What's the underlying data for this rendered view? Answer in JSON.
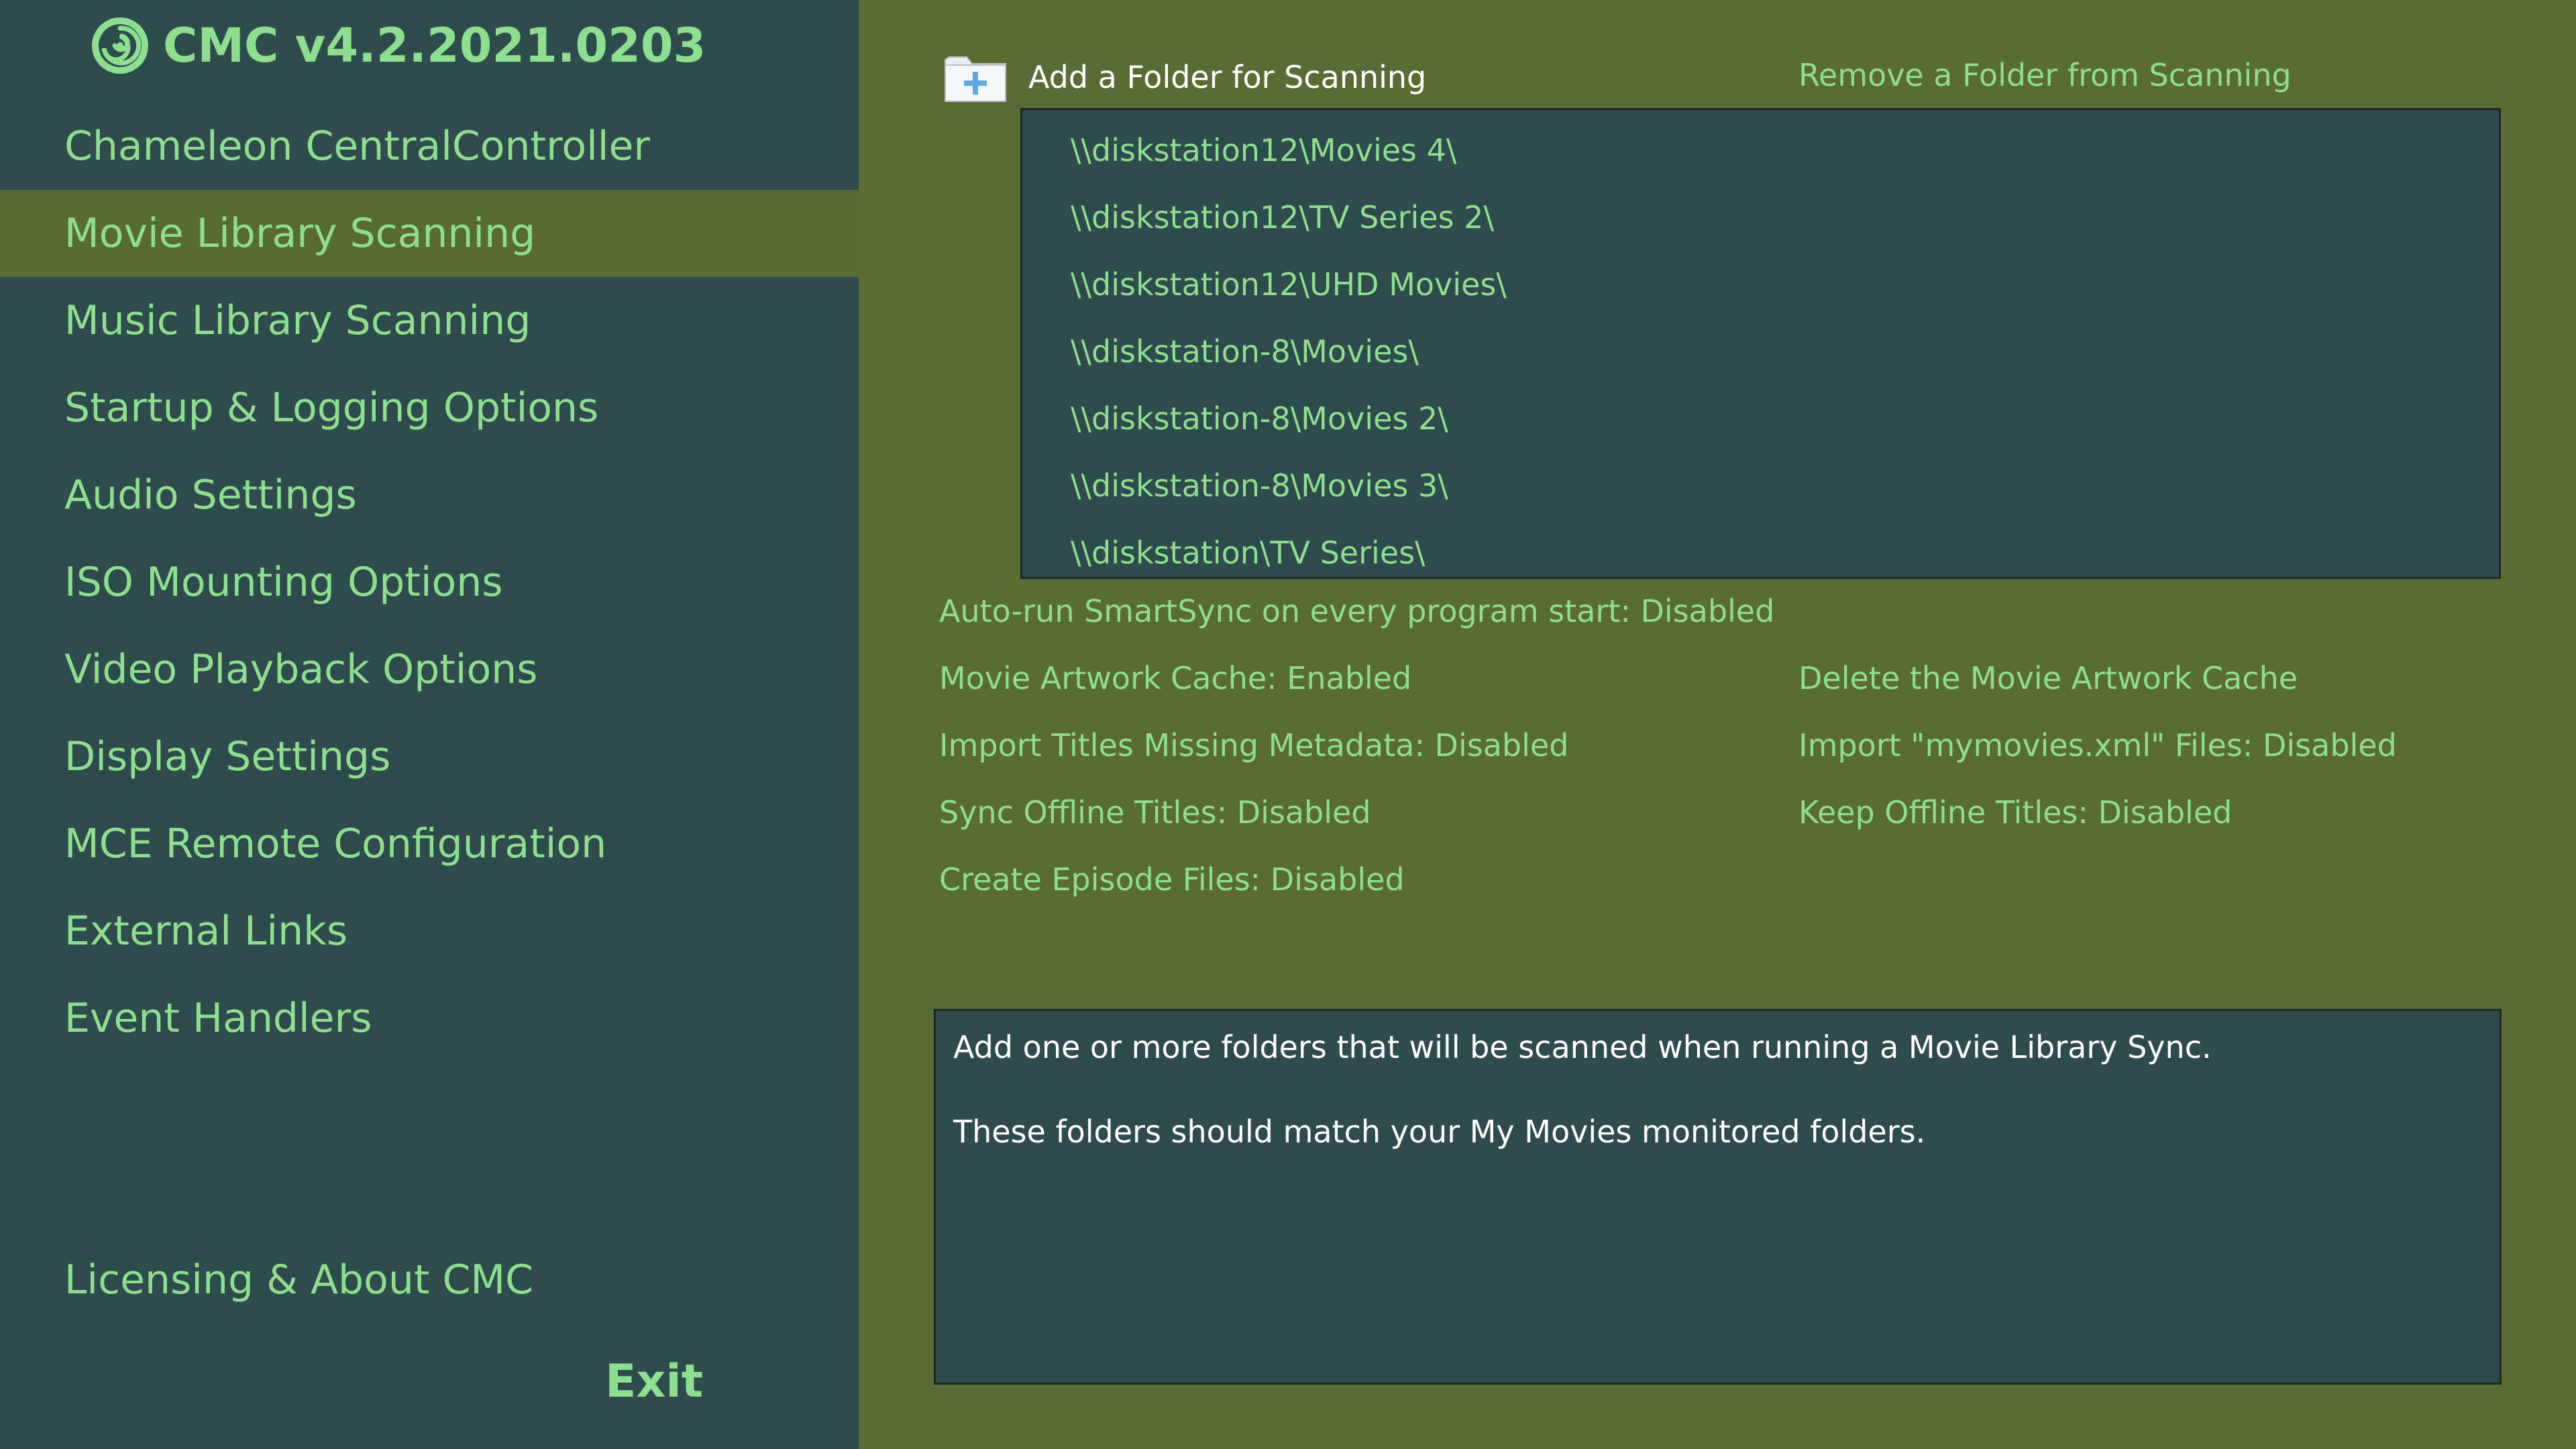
{
  "app": {
    "title": "CMC v4.2.2021.0203",
    "logo_icon": "chameleon-logo-icon"
  },
  "sidebar": {
    "items": [
      {
        "label": "Chameleon CentralController",
        "active": false
      },
      {
        "label": "Movie Library Scanning",
        "active": true
      },
      {
        "label": "Music Library Scanning",
        "active": false
      },
      {
        "label": "Startup & Logging Options",
        "active": false
      },
      {
        "label": "Audio Settings",
        "active": false
      },
      {
        "label": "ISO Mounting Options",
        "active": false
      },
      {
        "label": "Video Playback Options",
        "active": false
      },
      {
        "label": "Display Settings",
        "active": false
      },
      {
        "label": "MCE Remote Configuration",
        "active": false
      },
      {
        "label": "External Links",
        "active": false
      },
      {
        "label": "Event Handlers",
        "active": false
      }
    ],
    "licensing_label": "Licensing & About CMC",
    "exit_label": "Exit"
  },
  "main": {
    "add_folder_label": "Add a Folder for Scanning",
    "add_folder_icon": "add-folder-icon",
    "remove_folder_label": "Remove a Folder from Scanning",
    "folders": [
      "\\\\diskstation12\\Movies 4\\",
      "\\\\diskstation12\\TV Series 2\\",
      "\\\\diskstation12\\UHD Movies\\",
      "\\\\diskstation-8\\Movies\\",
      "\\\\diskstation-8\\Movies 2\\",
      "\\\\diskstation-8\\Movies 3\\",
      "\\\\diskstation\\TV Series\\"
    ],
    "options": {
      "auto_run": "Auto-run SmartSync on every program start:  Disabled",
      "artwork_cache": "Movie Artwork Cache:  Enabled",
      "delete_artwork": "Delete the Movie Artwork Cache",
      "import_missing": "Import Titles Missing Metadata:  Disabled",
      "import_xml": "Import \"mymovies.xml\" Files:  Disabled",
      "sync_offline": "Sync Offline Titles:  Disabled",
      "keep_offline": "Keep Offline Titles:  Disabled",
      "episode_files": "Create Episode Files:  Disabled"
    },
    "description": {
      "line1": "Add one or more folders that will be scanned when running a Movie Library Sync.",
      "line2": "These folders should match your My Movies monitored folders."
    }
  },
  "colors": {
    "sidebar_bg": "#2e4b4d",
    "active_item_bg": "#586c32",
    "main_bg": "#596c33",
    "accent_text": "#8ddf8d",
    "white_text": "#ffffff"
  }
}
